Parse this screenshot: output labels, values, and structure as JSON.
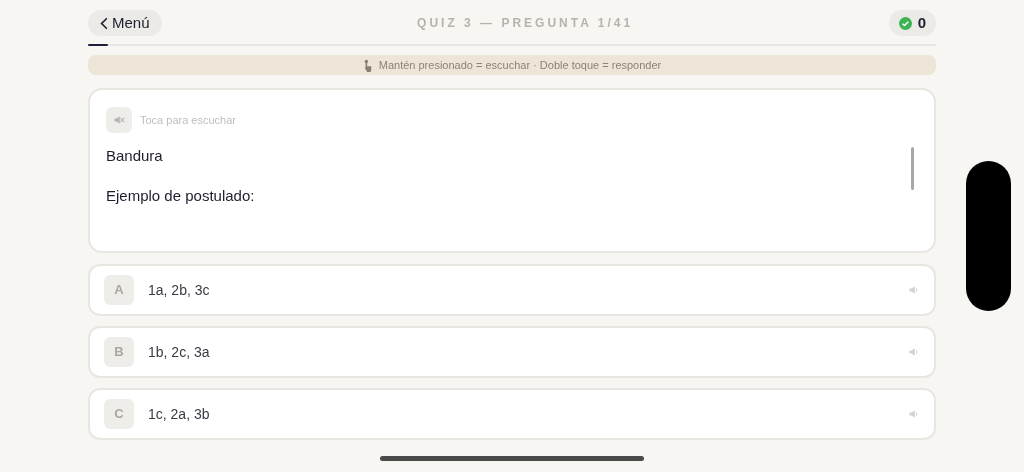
{
  "header": {
    "back_label": "Menú",
    "title": "QUIZ 3 — PREGUNTA 1/41",
    "score": "0"
  },
  "progress": {
    "level": 0.024
  },
  "hint": "Mantén presionado = escuchar · Doble toque = responder",
  "question": {
    "audio_label": "Toca para escuchar",
    "muted": true,
    "lines": [
      "Bandura",
      "Ejemplo de postulado:"
    ]
  },
  "options": [
    {
      "letter": "A",
      "text": "1a, 2b, 3c"
    },
    {
      "letter": "B",
      "text": "1b, 2c, 3a"
    },
    {
      "letter": "C",
      "text": "1c, 2a, 3b"
    }
  ]
}
